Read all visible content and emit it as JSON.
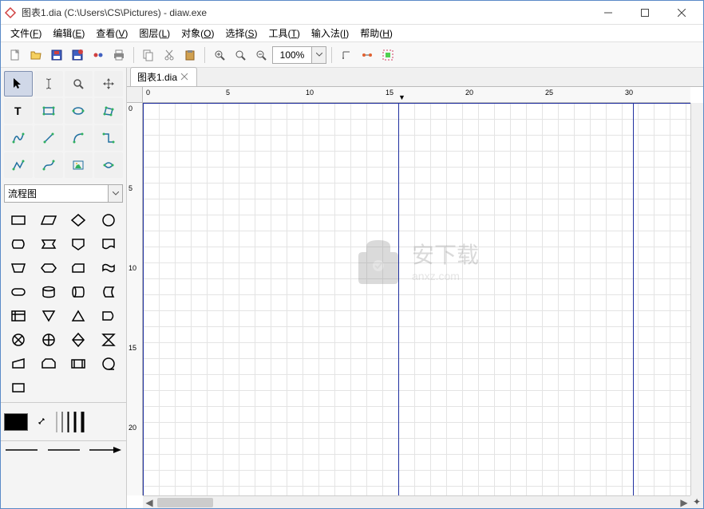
{
  "window": {
    "title": "图表1.dia (C:\\Users\\CS\\Pictures) - diaw.exe"
  },
  "menu": {
    "items": [
      {
        "label": "文件",
        "accel": "F"
      },
      {
        "label": "编辑",
        "accel": "E"
      },
      {
        "label": "查看",
        "accel": "V"
      },
      {
        "label": "图层",
        "accel": "L"
      },
      {
        "label": "对象",
        "accel": "O"
      },
      {
        "label": "选择",
        "accel": "S"
      },
      {
        "label": "工具",
        "accel": "T"
      },
      {
        "label": "输入法",
        "accel": "I"
      },
      {
        "label": "帮助",
        "accel": "H"
      }
    ]
  },
  "toolbar": {
    "zoom": "100%"
  },
  "sidebar": {
    "shape_category": "流程图"
  },
  "tabs": {
    "items": [
      {
        "label": "图表1.dia"
      }
    ]
  },
  "ruler_h": {
    "labels": [
      "0",
      "5",
      "10",
      "15",
      "20",
      "25",
      "30"
    ]
  },
  "ruler_v": {
    "labels": [
      "0",
      "5",
      "10",
      "15",
      "20"
    ]
  },
  "watermark": {
    "text": "安下载",
    "sub": "anxz.com"
  }
}
